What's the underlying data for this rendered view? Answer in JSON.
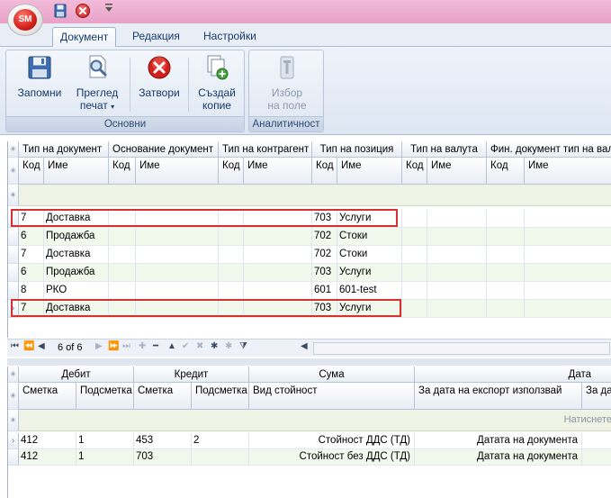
{
  "app": {
    "logo": "SM",
    "qat_icons": [
      "save-icon",
      "close-icon",
      "chevron-down-icon"
    ]
  },
  "tabs": [
    {
      "label": "Документ",
      "active": true
    },
    {
      "label": "Редакция",
      "active": false
    },
    {
      "label": "Настройки",
      "active": false
    }
  ],
  "ribbon": {
    "group1_label": "Основни",
    "group2_label": "Аналитичност",
    "save": {
      "line1": "Запомни",
      "line2": ""
    },
    "preview": {
      "line1": "Преглед",
      "line2": "печат"
    },
    "close": {
      "line1": "Затвори",
      "line2": ""
    },
    "copy": {
      "line1": "Създай",
      "line2": "копие"
    },
    "field": {
      "line1": "Избор",
      "line2": "на поле"
    }
  },
  "top_grid": {
    "bands": [
      "Тип на документ",
      "Основание документ",
      "Тип на контрагент",
      "Тип на позиция",
      "Тип на валута",
      "Фин. документ тип на вал"
    ],
    "sub": [
      "Код",
      "Име",
      "Код",
      "Име",
      "Код",
      "Име",
      "Код",
      "Име",
      "Код",
      "Име",
      "Код",
      "Име"
    ],
    "rows": [
      {
        "c1": "7",
        "n1": "Доставка",
        "c4": "703",
        "n4": "Услуги"
      },
      {
        "c1": "6",
        "n1": "Продажба",
        "c4": "702",
        "n4": "Стоки"
      },
      {
        "c1": "7",
        "n1": "Доставка",
        "c4": "702",
        "n4": "Стоки"
      },
      {
        "c1": "6",
        "n1": "Продажба",
        "c4": "703",
        "n4": "Услуги"
      },
      {
        "c1": "8",
        "n1": "РКО",
        "c4": "601",
        "n4": "601-test"
      },
      {
        "c1": "7",
        "n1": "Доставка",
        "c4": "703",
        "n4": "Услуги"
      }
    ]
  },
  "navigator": {
    "position": "6 of 6"
  },
  "bottom_grid": {
    "bands": [
      "Дебит",
      "Кредит",
      "Сума",
      "Дата"
    ],
    "sub": [
      "Сметка",
      "Подсметка",
      "Сметка",
      "Подсметка",
      "Вид стойност",
      "За дата на експорт използвай",
      "За дат"
    ],
    "filter_hint": "Натиснете",
    "rows": [
      {
        "s1": "412",
        "p1": "1",
        "s2": "453",
        "p2": "2",
        "vid": "Стойност ДДС (ТД)",
        "date": "Датата на документа"
      },
      {
        "s1": "412",
        "p1": "1",
        "s2": "703",
        "p2": "",
        "vid": "Стойност без ДДС (ТД)",
        "date": "Датата на документа"
      }
    ]
  },
  "colors": {
    "titlebar": "#e9a2c8",
    "highlight": "#d6302f",
    "alt_row": "#f1f8ec"
  }
}
